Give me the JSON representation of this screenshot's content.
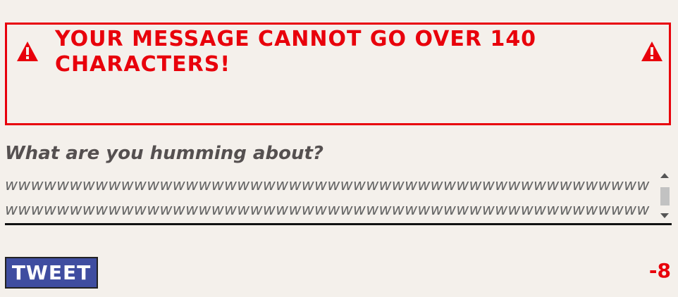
{
  "error": {
    "message": "YOUR MESSAGE CANNOT GO OVER 140 CHARACTERS!",
    "icon": "warning-triangle-icon",
    "color": "#e8000b"
  },
  "compose": {
    "label": "What are you humming about?",
    "value": "wwwwwwwwwwwwwwwwwwwwwwwwwwwwwwwwwwwwwwwwwwwwwwwwwwwwwwwwwwwwwwwwwwwwwwwwwwwwwwwwwwwwwwwwwwwwwwwwwwwwwwwwwwwwwwwwwwwwwwwwwwwwwwwwwwwwwwwwwwwwwww"
  },
  "actions": {
    "tweet_label": "TWEET",
    "tweet_color": "#3f4da0",
    "char_count": "-8"
  },
  "colors": {
    "background": "#f4f0eb"
  }
}
